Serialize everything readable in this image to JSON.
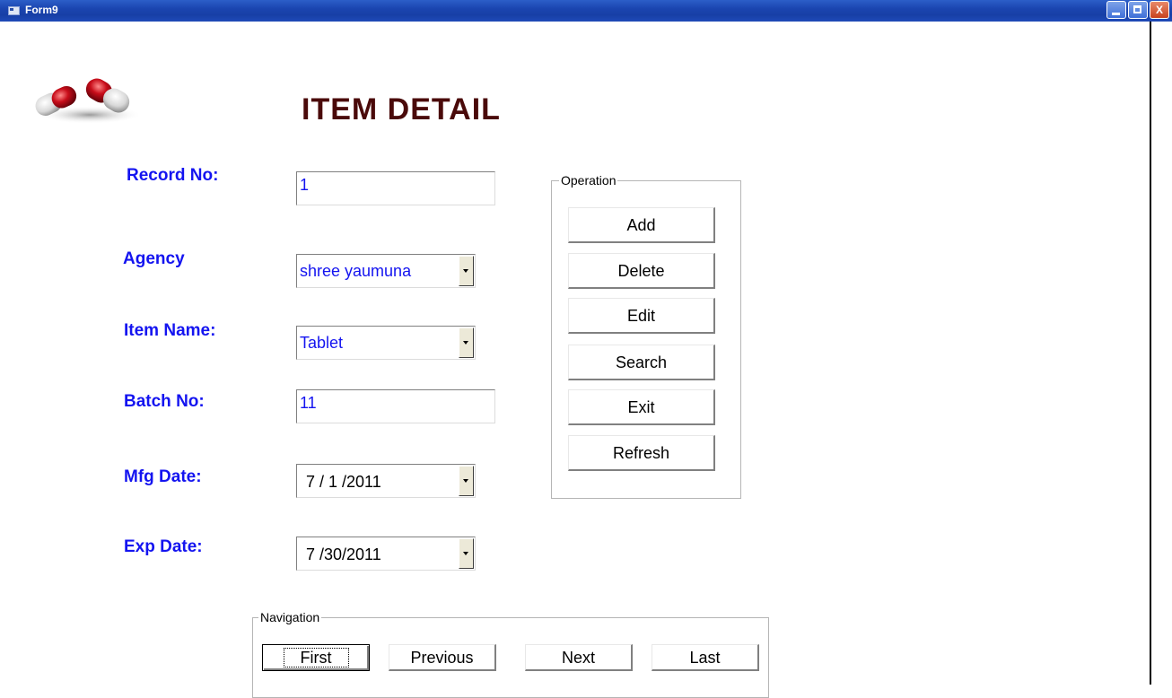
{
  "window": {
    "title": "Form9"
  },
  "heading": "ITEM DETAIL",
  "fields": {
    "record_no": {
      "label": "Record No:",
      "value": "1"
    },
    "agency": {
      "label": "Agency",
      "value": "shree yaumuna"
    },
    "item_name": {
      "label": "Item Name:",
      "value": "Tablet"
    },
    "batch_no": {
      "label": "Batch No:",
      "value": "11"
    },
    "mfg_date": {
      "label": "Mfg Date:",
      "value": "7 / 1 /2011"
    },
    "exp_date": {
      "label": "Exp Date:",
      "value": "7 /30/2011"
    }
  },
  "operation": {
    "title": "Operation",
    "buttons": [
      "Add",
      "Delete",
      "Edit",
      "Search",
      "Exit",
      "Refresh"
    ]
  },
  "navigation": {
    "title": "Navigation",
    "buttons": [
      "First",
      "Previous",
      "Next",
      "Last"
    ]
  },
  "colors": {
    "label": "#1414f0",
    "heading": "#4a0a0a",
    "titlebar": "#1b45b0"
  }
}
